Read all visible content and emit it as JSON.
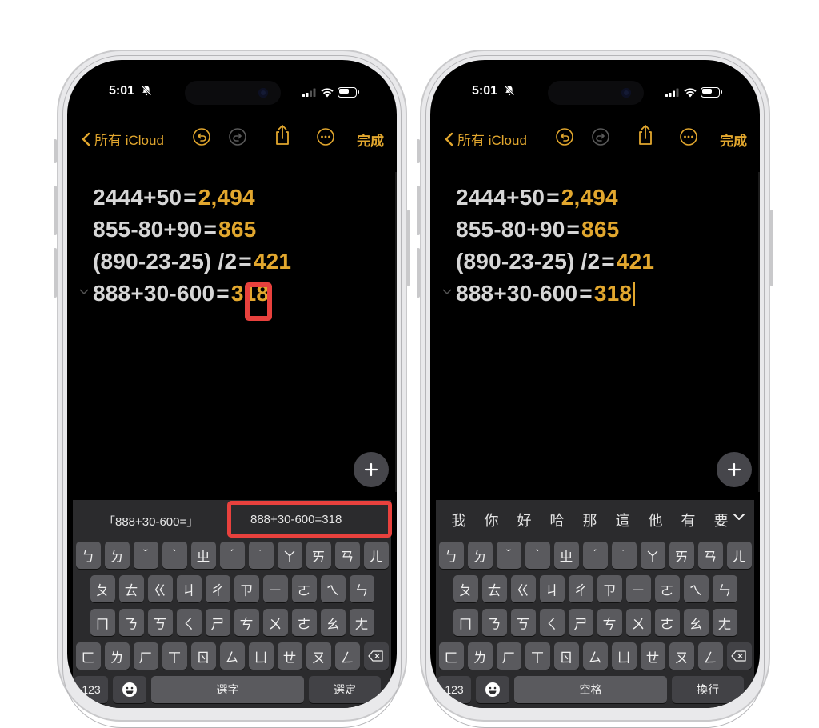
{
  "colors": {
    "accent": "#e2a72e",
    "highlight": "#e8413d",
    "text": "#d6d6d6",
    "keyboard": "#2b2b2d"
  },
  "left": {
    "status": {
      "time": "5:01"
    },
    "toolbar": {
      "back_label": "所有 iCloud",
      "done_label": "完成"
    },
    "note": {
      "lines": [
        {
          "expr": "2444+50",
          "eq": "=",
          "result": "2,494"
        },
        {
          "expr": "855-80+90",
          "eq": "=",
          "result": "865"
        },
        {
          "expr": "(890-23-25) /2",
          "eq": "=",
          "result": "421"
        },
        {
          "expr": "888+30-600",
          "eq": "=",
          "result": "318"
        }
      ]
    },
    "candidates": {
      "left": "「888+30-600=」",
      "right": "888+30-600=318"
    },
    "keyboard": {
      "row1": [
        "ㄅ",
        "ㄉ",
        "ˇ",
        "ˋ",
        "ㄓ",
        "ˊ",
        "˙",
        "ㄚ",
        "ㄞ",
        "ㄢ",
        "ㄦ"
      ],
      "row2": [
        "ㄆ",
        "ㄊ",
        "ㄍ",
        "ㄐ",
        "ㄔ",
        "ㄗ",
        "ㄧ",
        "ㄛ",
        "ㄟ",
        "ㄣ"
      ],
      "row3": [
        "ㄇ",
        "ㄋ",
        "ㄎ",
        "ㄑ",
        "ㄕ",
        "ㄘ",
        "ㄨ",
        "ㄜ",
        "ㄠ",
        "ㄤ"
      ],
      "row4": [
        "ㄈ",
        "ㄌ",
        "ㄏ",
        "ㄒ",
        "ㄖ",
        "ㄙ",
        "ㄩ",
        "ㄝ",
        "ㄡ",
        "ㄥ"
      ],
      "numbers_label": "123",
      "space_label": "選字",
      "return_label": "選定"
    }
  },
  "right": {
    "status": {
      "time": "5:01"
    },
    "toolbar": {
      "back_label": "所有 iCloud",
      "done_label": "完成"
    },
    "note": {
      "lines": [
        {
          "expr": "2444+50",
          "eq": "=",
          "result": "2,494"
        },
        {
          "expr": "855-80+90",
          "eq": "=",
          "result": "865"
        },
        {
          "expr": "(890-23-25) /2",
          "eq": "=",
          "result": "421"
        },
        {
          "expr": "888+30-600",
          "eq": "=",
          "result": "318"
        }
      ]
    },
    "candidates": {
      "chars": [
        "我",
        "你",
        "好",
        "哈",
        "那",
        "這",
        "他",
        "有",
        "要"
      ]
    },
    "keyboard": {
      "row1": [
        "ㄅ",
        "ㄉ",
        "ˇ",
        "ˋ",
        "ㄓ",
        "ˊ",
        "˙",
        "ㄚ",
        "ㄞ",
        "ㄢ",
        "ㄦ"
      ],
      "row2": [
        "ㄆ",
        "ㄊ",
        "ㄍ",
        "ㄐ",
        "ㄔ",
        "ㄗ",
        "ㄧ",
        "ㄛ",
        "ㄟ",
        "ㄣ"
      ],
      "row3": [
        "ㄇ",
        "ㄋ",
        "ㄎ",
        "ㄑ",
        "ㄕ",
        "ㄘ",
        "ㄨ",
        "ㄜ",
        "ㄠ",
        "ㄤ"
      ],
      "row4": [
        "ㄈ",
        "ㄌ",
        "ㄏ",
        "ㄒ",
        "ㄖ",
        "ㄙ",
        "ㄩ",
        "ㄝ",
        "ㄡ",
        "ㄥ"
      ],
      "numbers_label": "123",
      "space_label": "空格",
      "return_label": "換行"
    }
  }
}
